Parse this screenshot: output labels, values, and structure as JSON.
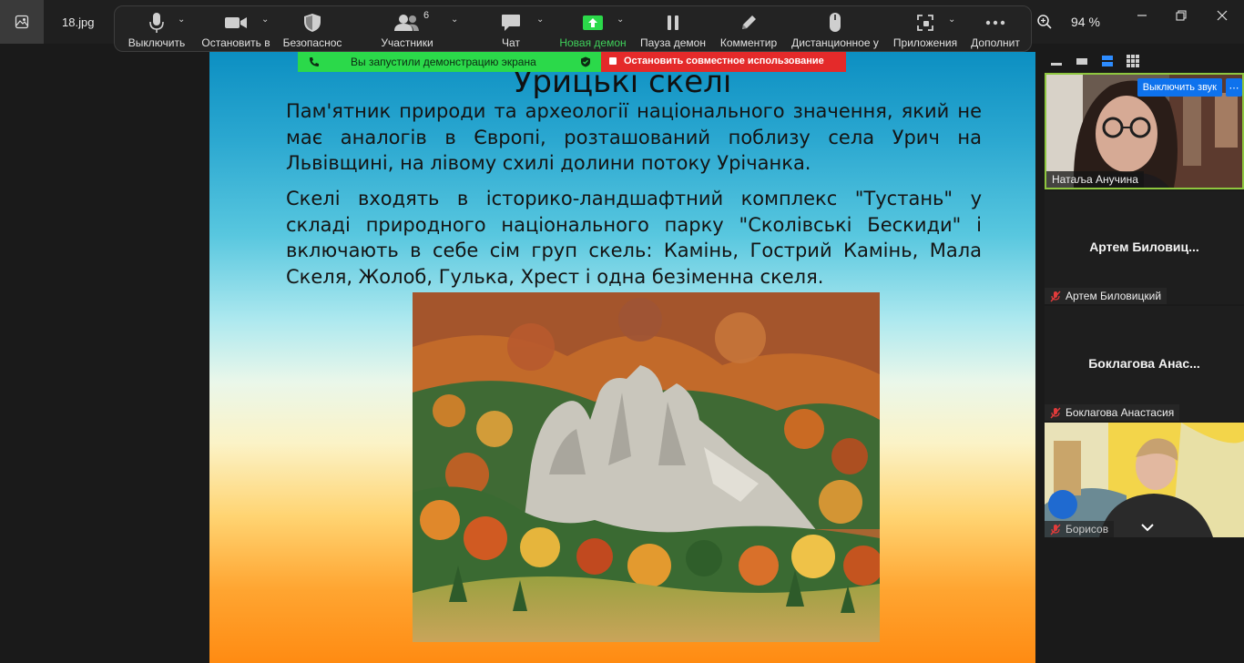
{
  "window": {
    "filename": "18.jpg",
    "zoom_level": "94 %"
  },
  "toolbar": {
    "items": [
      {
        "label": "Выключить",
        "icon": "microphone-icon"
      },
      {
        "label": "Остановить в",
        "icon": "video-camera-icon"
      },
      {
        "label": "Безопаснос",
        "icon": "shield-icon"
      },
      {
        "label": "Участники",
        "icon": "participants-icon",
        "count": "6"
      },
      {
        "label": "Чат",
        "icon": "chat-icon"
      },
      {
        "label": "Новая демон",
        "icon": "share-screen-icon"
      },
      {
        "label": "Пауза демон",
        "icon": "pause-icon"
      },
      {
        "label": "Комментир",
        "icon": "pencil-icon"
      },
      {
        "label": "Дистанционное у",
        "icon": "mouse-icon"
      },
      {
        "label": "Приложения",
        "icon": "apps-icon"
      },
      {
        "label": "Дополнит",
        "icon": "more-dots-icon"
      }
    ]
  },
  "share_banner": {
    "status": "Вы запустили демонстрацию экрана",
    "stop": "Остановить совместное использование"
  },
  "slide": {
    "title": "Урицькі скелі",
    "paragraph1": "Пам'ятник природи та археології національного значення, який не має аналогів в Європі, розташований поблизу села Урич на Львівщині, на лівому схилі долини потоку Урічанка.",
    "paragraph2": "Скелі входять в історико-ландшафтний комплекс \"Тустань\" у складі природного національного парку \"Сколівські Бескиди\" і включають в себе сім груп скель: Камінь, Гострий Камінь, Мала Скеля, Жолоб, Гулька, Хрест і одна безіменна скеля.",
    "image": "autumn-rocks-photo"
  },
  "participants": {
    "tiles": [
      {
        "name": "Натаља Анучина",
        "mute_button": "Выключить звук",
        "video": true
      },
      {
        "display": "Артем  Биловиц...",
        "name": "Артем Биловицкий",
        "muted": true
      },
      {
        "display": "Боклагова  Анас...",
        "name": "Боклагова Анастасия",
        "muted": true
      },
      {
        "name": "Борисов",
        "muted": true,
        "video": true
      }
    ]
  },
  "colors": {
    "share_green": "#2bd94a",
    "stop_red": "#e42a2a",
    "active_border": "#8ec63f",
    "button_blue": "#0e72ed",
    "new_share_green": "#3fcf5a"
  }
}
